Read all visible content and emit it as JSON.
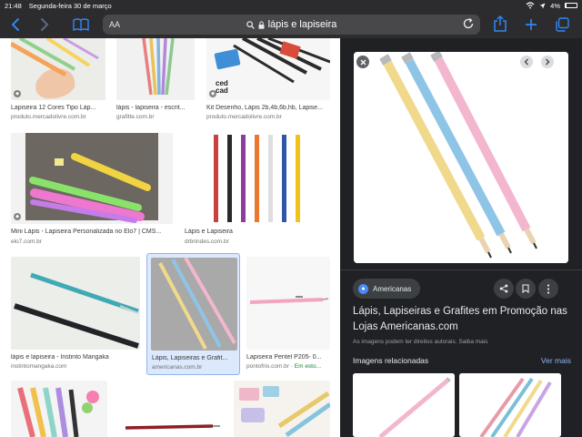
{
  "status": {
    "time": "21:48",
    "date": "Segunda-feira 30 de março",
    "battery": "4%"
  },
  "toolbar": {
    "aa_label": "AA",
    "address": "lápis e lapiseira"
  },
  "results": [
    {
      "title": "Lapiseira 12 Cores Tipo Láp...",
      "source": "produto.mercadolivre.com.br"
    },
    {
      "title": "lápis - lapiseira - escrit...",
      "source": "grafitte.com.br"
    },
    {
      "title": "Kit Desenho, Lápis 2b,4b,6b,hb, Lapise...",
      "source": "produto.mercadolivre.com.br",
      "logo_text": "ced cad"
    },
    {
      "title": "Mini Lápis - Lapiseira Personalizada no Elo7 | CMS...",
      "source": "elo7.com.br"
    },
    {
      "title": "Lápis e Lapiseira",
      "source": "drbrindes.com.br"
    },
    {
      "title": "lápis e lapiseira - Instinto Mangaka",
      "source": "instintomangaka.com"
    },
    {
      "title": "Lápis, Lapiseiras e Grafit...",
      "source": "americanas.com.br"
    },
    {
      "title": "Lapiseira Pentel P205- 0...",
      "source": "pontofrio.com.br",
      "stock": "Em esto..."
    }
  ],
  "panel": {
    "source_name": "Americanas",
    "title": "Lápis, Lapiseiras e Grafites em Promoção nas Lojas Americanas.com",
    "copyright": "As imagens podem ter direitos autorais. Saiba mais",
    "related_heading": "Imagens relacionadas",
    "see_more": "Ver mais"
  },
  "colors": {
    "safari_accent": "#2f86f5",
    "panel_bg": "#202124",
    "pencil_yellow": "#f1d98c",
    "pencil_blue": "#8ec5e6",
    "pencil_pink": "#f3b6cf"
  }
}
